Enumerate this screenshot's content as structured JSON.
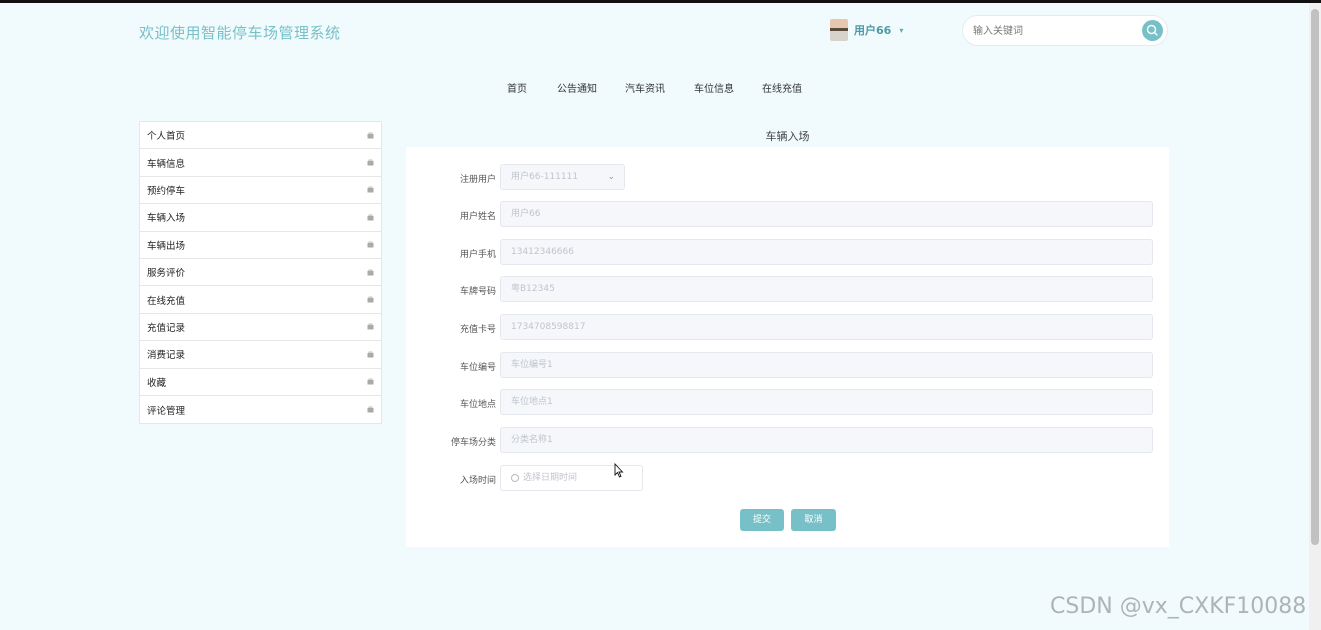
{
  "header": {
    "app_title": "欢迎使用智能停车场管理系统",
    "username": "用户66",
    "search_placeholder": "输入关键词"
  },
  "nav": [
    "首页",
    "公告通知",
    "汽车资讯",
    "车位信息",
    "在线充值"
  ],
  "sidebar": [
    "个人首页",
    "车辆信息",
    "预约停车",
    "车辆入场",
    "车辆出场",
    "服务评价",
    "在线充值",
    "充值记录",
    "消费记录",
    "收藏",
    "评论管理"
  ],
  "form": {
    "heading": "车辆入场",
    "fields": [
      {
        "label": "注册用户",
        "value": "用户66-111111"
      },
      {
        "label": "用户姓名",
        "value": "用户66"
      },
      {
        "label": "用户手机",
        "value": "13412346666"
      },
      {
        "label": "车牌号码",
        "value": "粤B12345"
      },
      {
        "label": "充值卡号",
        "value": "1734708598817"
      },
      {
        "label": "车位编号",
        "value": "车位编号1"
      },
      {
        "label": "车位地点",
        "value": "车位地点1"
      },
      {
        "label": "停车场分类",
        "value": "分类名称1"
      },
      {
        "label": "入场时间",
        "placeholder": "选择日期时间"
      }
    ],
    "submit_label": "提交",
    "cancel_label": "取消"
  },
  "watermark": "CSDN @vx_CXKF10088",
  "colors": {
    "accent": "#78c0c7",
    "background": "#f1fbfd"
  }
}
